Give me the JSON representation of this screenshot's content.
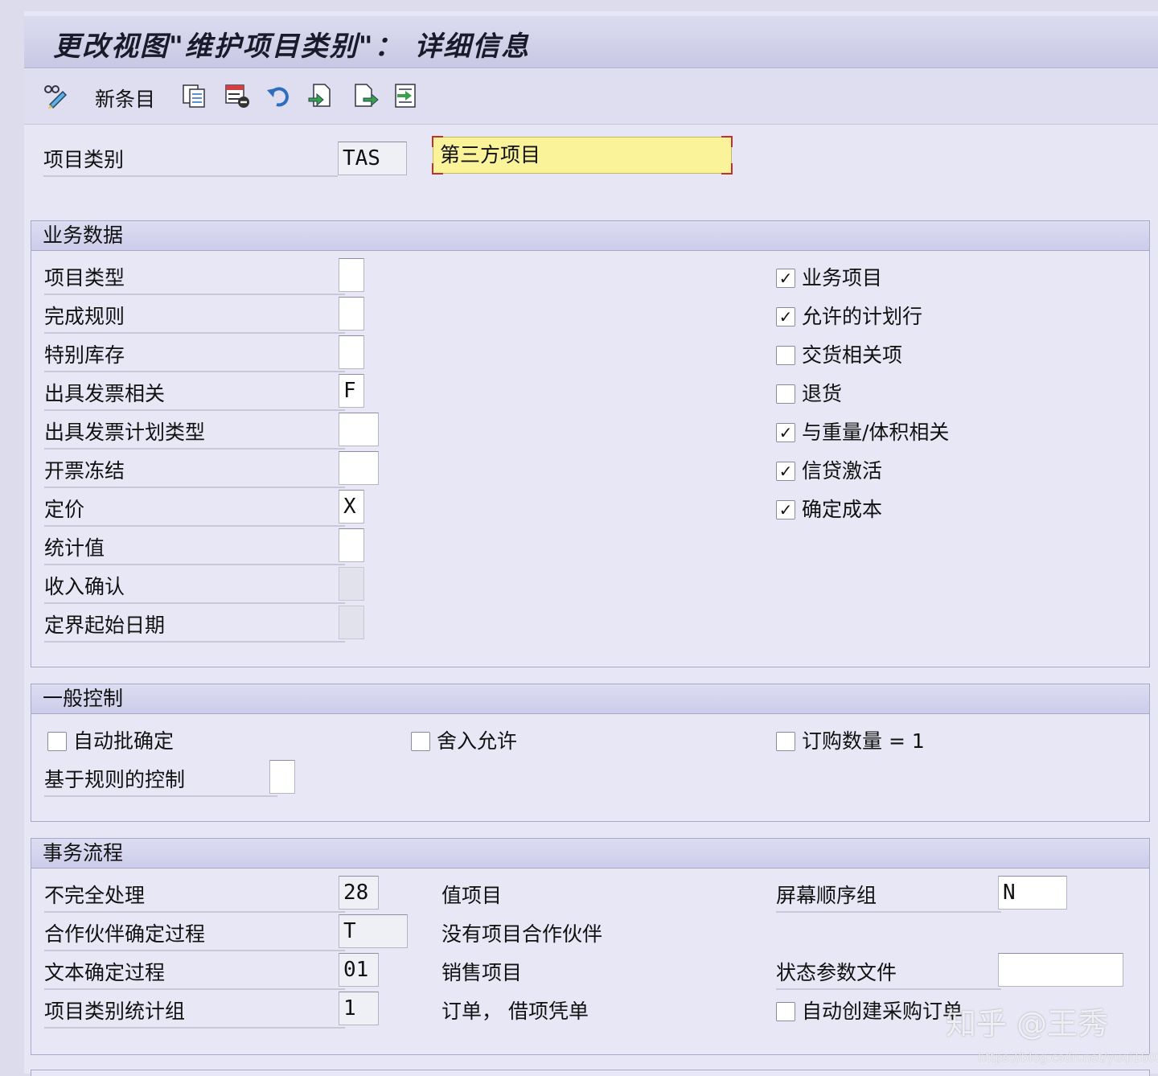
{
  "title": "更改视图\"维护项目类别\"： 详细信息",
  "toolbar": {
    "new_entries_label": "新条目",
    "icons": [
      "display-change-icon",
      "copy-icon",
      "delete-icon",
      "undo-icon",
      "select-all-icon",
      "next-entry-icon",
      "transport-icon"
    ]
  },
  "header": {
    "item_category_label": "项目类别",
    "item_category_value": "TAS",
    "item_category_desc": "第三方项目"
  },
  "business_data": {
    "title": "业务数据",
    "fields": [
      {
        "label": "项目类型",
        "value": ""
      },
      {
        "label": "完成规则",
        "value": ""
      },
      {
        "label": "特别库存",
        "value": ""
      },
      {
        "label": "出具发票相关",
        "value": "F"
      },
      {
        "label": "出具发票计划类型",
        "value": ""
      },
      {
        "label": "开票冻结",
        "value": ""
      },
      {
        "label": "定价",
        "value": "X"
      },
      {
        "label": "统计值",
        "value": ""
      },
      {
        "label": "收入确认",
        "value": ""
      },
      {
        "label": "定界起始日期",
        "value": ""
      }
    ],
    "checkboxes": [
      {
        "label": "业务项目",
        "checked": true
      },
      {
        "label": "允许的计划行",
        "checked": true
      },
      {
        "label": "交货相关项",
        "checked": false
      },
      {
        "label": "退货",
        "checked": false
      },
      {
        "label": "与重量/体积相关",
        "checked": true
      },
      {
        "label": "信贷激活",
        "checked": true
      },
      {
        "label": "确定成本",
        "checked": true
      }
    ]
  },
  "general_control": {
    "title": "一般控制",
    "checkboxes": [
      {
        "label": "自动批确定",
        "checked": false
      },
      {
        "label": "舍入允许",
        "checked": false
      },
      {
        "label": "订购数量 = 1",
        "checked": false
      }
    ],
    "rule_control_label": "基于规则的控制",
    "rule_control_value": ""
  },
  "transaction_flow": {
    "title": "事务流程",
    "rows": [
      {
        "label": "不完全处理",
        "value": "28",
        "desc": "值项目"
      },
      {
        "label": "合作伙伴确定过程",
        "value": "T",
        "desc": "没有项目合作伙伴"
      },
      {
        "label": "文本确定过程",
        "value": "01",
        "desc": "销售项目"
      },
      {
        "label": "项目类别统计组",
        "value": "1",
        "desc": "订单， 借项凭单"
      }
    ],
    "screen_seq_label": "屏幕顺序组",
    "screen_seq_value": "N",
    "status_profile_label": "状态参数文件",
    "status_profile_value": "",
    "auto_po_label": "自动创建采购订单",
    "auto_po_checked": false
  },
  "watermark": "知乎 @王秀",
  "watermark_url": "https://blog.csdn.net/yuqi1602",
  "check_mark": "✓"
}
